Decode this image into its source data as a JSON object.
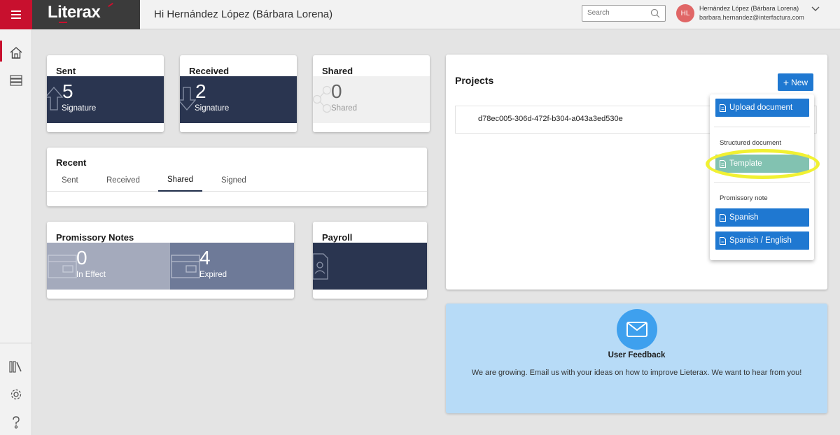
{
  "header": {
    "logo": "Literax",
    "greeting": "Hi Hernández López (Bárbara Lorena)",
    "search_placeholder": "Search",
    "user_initials": "HL",
    "user_name": "Hernández López (Bárbara Lorena)",
    "user_email": "barbara.hernandez@interfactura.com"
  },
  "sidebar": {
    "top_icons": [
      "home-icon",
      "list-icon"
    ],
    "bottom_icons": [
      "library-icon",
      "gear-icon",
      "help-icon"
    ]
  },
  "cards": {
    "sent": {
      "title": "Sent",
      "count": "5",
      "label": "Signature"
    },
    "received": {
      "title": "Received",
      "count": "2",
      "label": "Signature"
    },
    "shared": {
      "title": "Shared",
      "count": "0",
      "label": "Shared"
    },
    "recent": {
      "title": "Recent",
      "tabs": [
        "Sent",
        "Received",
        "Shared",
        "Signed"
      ],
      "active_tab": "Shared"
    },
    "promissory": {
      "title": "Promissory Notes",
      "in_effect_count": "0",
      "in_effect_label": "In Effect",
      "expired_count": "4",
      "expired_label": "Expired"
    },
    "payroll": {
      "title": "Payroll"
    }
  },
  "projects": {
    "title": "Projects",
    "new_label": "New",
    "items": [
      "d78ec005-306d-472f-b304-a043a3ed530e"
    ]
  },
  "dropdown": {
    "upload": "Upload document",
    "structured_header": "Structured document",
    "template": "Template",
    "promissory_header": "Promissory note",
    "spanish": "Spanish",
    "spanish_english": "Spanish / English"
  },
  "feedback": {
    "title": "User Feedback",
    "text": "We are growing. Email us with your ideas on how to improve Lieterax. We want to hear from you!"
  },
  "colors": {
    "brand_red": "#c8102e",
    "navy": "#2a3550",
    "primary_blue": "#1f78d1",
    "template_teal": "#82c2b1",
    "highlight_yellow": "#f1f132",
    "feedback_bg": "#b7dbf7"
  }
}
